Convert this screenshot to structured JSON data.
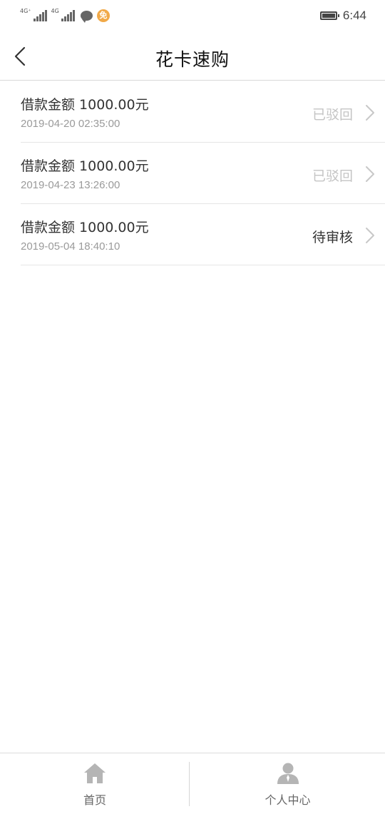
{
  "status_bar": {
    "net1_label": "4G⁺",
    "net2_label": "4G",
    "coin_glyph": "免",
    "time": "6:44",
    "icons": [
      "signal-icon",
      "signal-icon",
      "chat-bubble-icon",
      "coin-icon",
      "battery-icon"
    ]
  },
  "header": {
    "title": "花卡速购",
    "back_icon": "chevron-left-icon"
  },
  "loans": [
    {
      "title": "借款金额 1000.00元",
      "date": "2019-04-20 02:35:00",
      "status": "已驳回"
    },
    {
      "title": "借款金额 1000.00元",
      "date": "2019-04-23 13:26:00",
      "status": "已驳回"
    },
    {
      "title": "借款金额 1000.00元",
      "date": "2019-05-04 18:40:10",
      "status": "待审核"
    }
  ],
  "tabbar": {
    "home_label": "首页",
    "home_icon": "home-icon",
    "profile_label": "个人中心",
    "profile_icon": "user-icon"
  },
  "colors": {
    "status_rejected": "#c4c4c4",
    "status_pending": "#333333",
    "tab_icon": "#b5b5b5"
  }
}
